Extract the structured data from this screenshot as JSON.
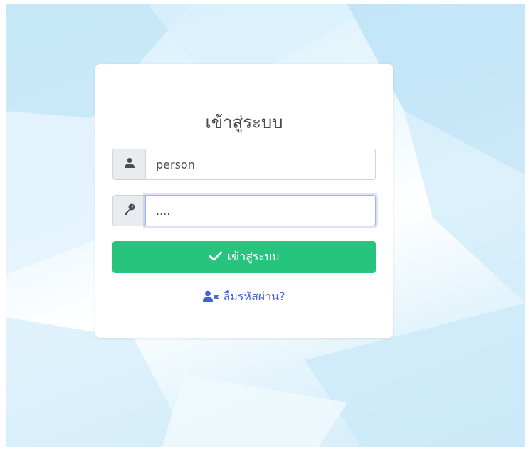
{
  "login": {
    "title": "เข้าสู่ระบบ",
    "username_value": "person",
    "password_value": "....",
    "submit_label": "เข้าสู่ระบบ",
    "forgot_label": "ลืมรหัสผ่าน?"
  },
  "colors": {
    "accent_green": "#27c47e",
    "link_blue": "#3f63d6",
    "addon_gray": "#e9ecef"
  },
  "icons": [
    "user-icon",
    "key-icon",
    "check-icon",
    "user-times-icon"
  ]
}
